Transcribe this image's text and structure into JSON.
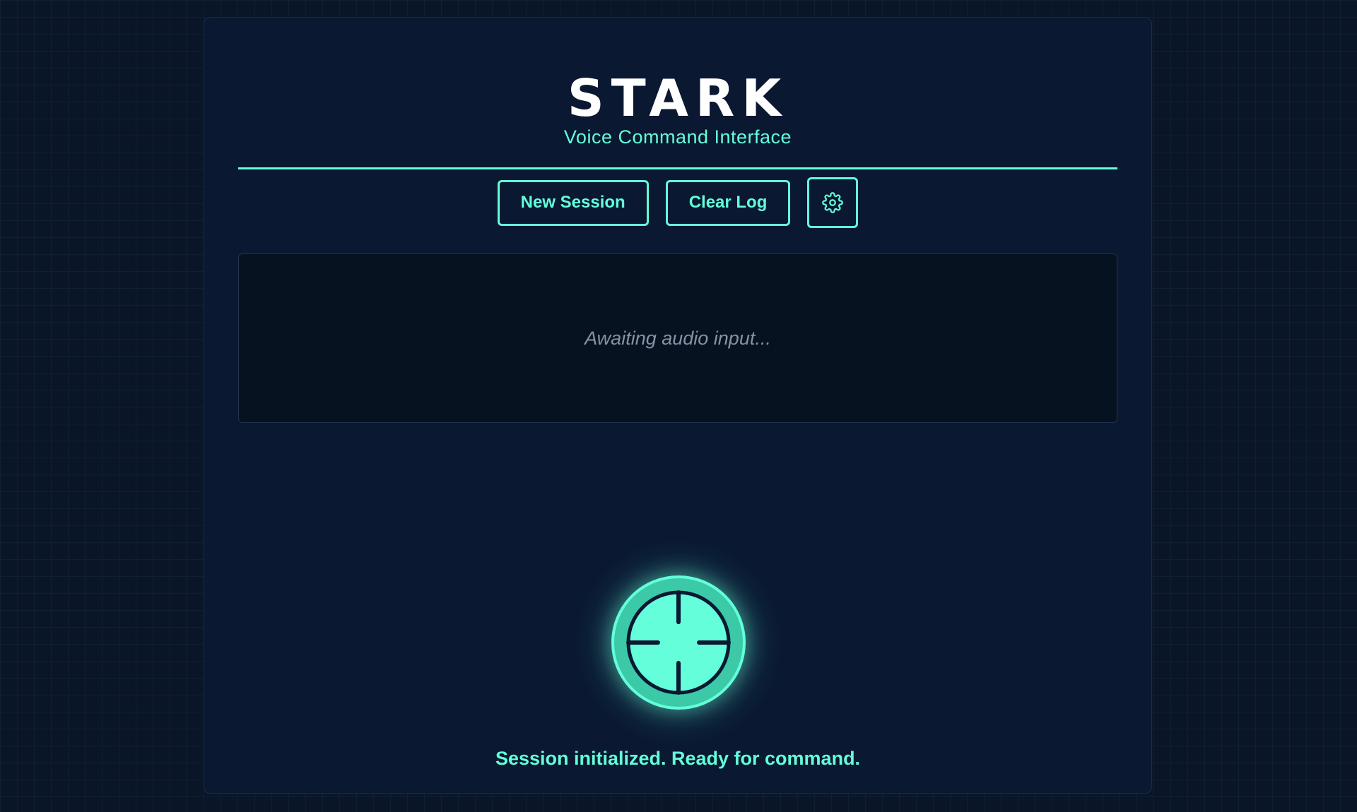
{
  "header": {
    "title": "STARK",
    "subtitle": "Voice Command Interface"
  },
  "toolbar": {
    "new_session_label": "New Session",
    "clear_log_label": "Clear Log",
    "settings_icon": "gear-icon"
  },
  "log": {
    "placeholder": "Awaiting audio input..."
  },
  "mic": {
    "icon": "crosshair-icon"
  },
  "status": {
    "message": "Session initialized. Ready for command."
  },
  "colors": {
    "accent": "#64ffda",
    "background": "#0a1628",
    "panel": "#0a1831",
    "log_background": "#06121f",
    "placeholder_text": "#8892a6",
    "title_text": "#ffffff"
  }
}
